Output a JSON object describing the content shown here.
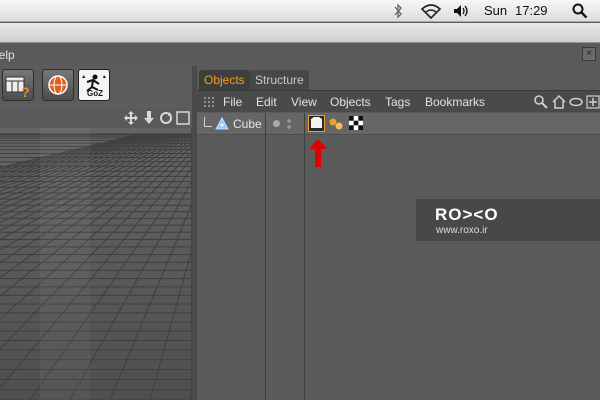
{
  "system_menubar": {
    "day": "Sun",
    "time": "17:29",
    "icons": [
      "bluetooth-icon",
      "wifi-icon",
      "volume-icon",
      "spotlight-search-icon"
    ]
  },
  "app_menu": {
    "help_label": "Help"
  },
  "left_toolbar": {
    "tools": [
      "calendar-help-tool",
      "sphere-render-tool",
      "goz-tool"
    ],
    "goz_label": "GoZ"
  },
  "objects_panel": {
    "tabs": [
      {
        "label": "Objects",
        "active": true
      },
      {
        "label": "Structure",
        "active": false
      }
    ],
    "menu": [
      "File",
      "Edit",
      "View",
      "Objects",
      "Tags",
      "Bookmarks"
    ],
    "menu_icons": [
      "search-icon",
      "home-icon",
      "link-icon",
      "expand-icon"
    ],
    "objects": [
      {
        "name": "Cube",
        "tags": [
          "texture-tag",
          "material-spheres-tag",
          "checker-tag"
        ]
      }
    ]
  },
  "watermark": {
    "logo": "RO><O",
    "url": "www.roxo.ir"
  },
  "colors": {
    "active_tab": "#f0a020",
    "arrow": "#e00000",
    "panel_bg": "#5b5b5b"
  }
}
